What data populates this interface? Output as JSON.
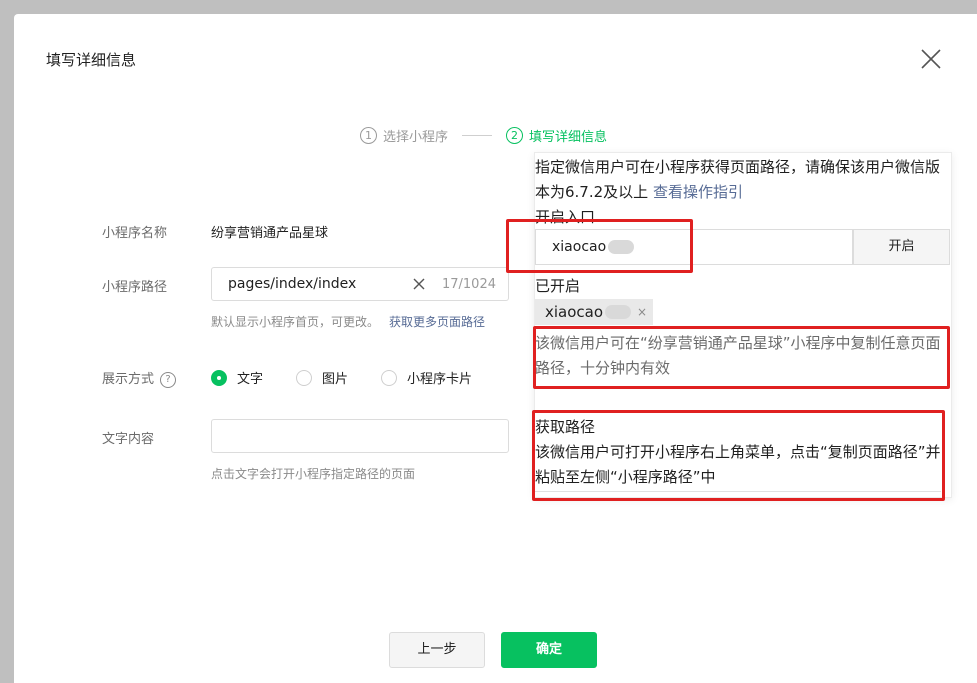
{
  "dialog": {
    "title": "填写详细信息",
    "close_icon": "close-icon"
  },
  "steps": [
    {
      "num": "1",
      "label": "选择小程序",
      "active": false
    },
    {
      "num": "2",
      "label": "填写详细信息",
      "active": true
    }
  ],
  "form": {
    "name_label": "小程序名称",
    "name_value": "纷享营销通产品星球",
    "path_label": "小程序路径",
    "path_value": "pages/index/index",
    "path_count": "17/1024",
    "path_hint": "默认显示小程序首页，可更改。",
    "path_hint_link": "获取更多页面路径",
    "display_label": "展示方式",
    "display_help": "?",
    "display_options": [
      "文字",
      "图片",
      "小程序卡片"
    ],
    "display_selected": "文字",
    "text_label": "文字内容",
    "text_value": "",
    "text_hint": "点击文字会打开小程序指定路径的页面"
  },
  "buttons": {
    "prev": "上一步",
    "ok": "确定"
  },
  "popup": {
    "intro": "指定微信用户可在小程序获得页面路径，请确保该用户微信版本为6.7.2及以上",
    "intro_link": "查看操作指引",
    "enable_title": "开启入口",
    "enable_input_value": "xiaocao",
    "enable_button": "开启",
    "enabled_title": "已开启",
    "enabled_tag": "xiaocao",
    "enabled_tag_close": "×",
    "enabled_note": "该微信用户可在“纷享营销通产品星球”小程序中复制任意页面路径，十分钟内有效",
    "get_path_title": "获取路径",
    "get_path_desc": "该微信用户可打开小程序右上角菜单，点击“复制页面路径”并粘贴至左侧“小程序路径”中"
  },
  "colors": {
    "accent": "#07c160",
    "link": "#576b95",
    "highlight_box": "#e02020"
  }
}
